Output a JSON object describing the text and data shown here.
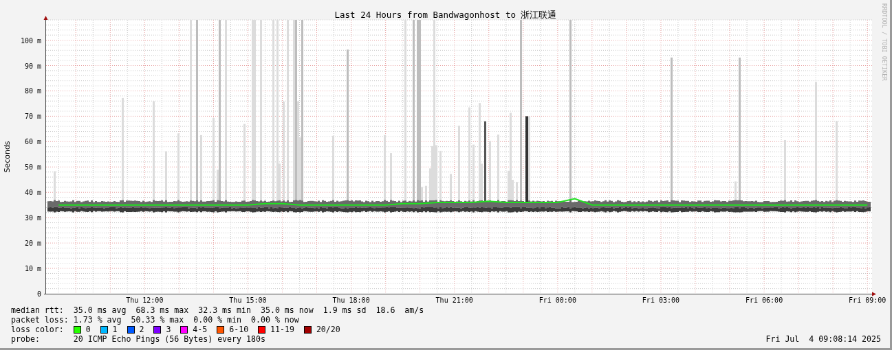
{
  "chart_data": {
    "type": "line",
    "title": "Last 24 Hours from Bandwagonhost to 浙江联通",
    "ylabel": "Seconds",
    "categories": [
      null,
      null,
      null,
      null,
      null,
      "Thu 12:00",
      null,
      null,
      null,
      null,
      null,
      "Thu 15:00",
      null,
      null,
      null,
      null,
      null,
      "Thu 18:00",
      null,
      null,
      null,
      null,
      null,
      "Thu 21:00",
      null,
      null,
      null,
      null,
      null,
      "Fri 00:00",
      null,
      null,
      null,
      null,
      null,
      "Fri 03:00",
      null,
      null,
      null,
      null,
      null,
      "Fri 06:00",
      null,
      null,
      null,
      null,
      null,
      "Fri 09:00"
    ],
    "series": [
      {
        "name": "median rtt:",
        "color": "#20e020",
        "values": [
          35,
          35,
          35,
          35,
          35,
          35,
          35,
          35,
          35,
          35,
          35,
          35,
          35.5,
          35.5,
          35,
          35,
          35,
          35,
          35,
          35,
          35.5,
          35.5,
          36,
          36,
          36,
          36.5,
          36,
          36,
          36,
          36,
          37.5,
          35,
          35,
          35,
          35,
          35,
          35,
          35,
          35,
          35,
          35,
          35,
          35,
          35,
          35,
          35,
          35,
          35
        ]
      }
    ],
    "ylim": [
      0,
      108
    ],
    "grid": true,
    "yticks": [
      {
        "value": 0,
        "label": "0"
      },
      {
        "value": 10,
        "label": "10 m"
      },
      {
        "value": 20,
        "label": "20 m"
      },
      {
        "value": 30,
        "label": "30 m"
      },
      {
        "value": 40,
        "label": "40 m"
      },
      {
        "value": 50,
        "label": "50 m"
      },
      {
        "value": 60,
        "label": "60 m"
      },
      {
        "value": 70,
        "label": "70 m"
      },
      {
        "value": 80,
        "label": "80 m"
      },
      {
        "value": 90,
        "label": "90 m"
      },
      {
        "value": 100,
        "label": "100 m"
      }
    ]
  },
  "credit": "RRDTOOL / TOBI OETIKER",
  "legend": {
    "median_rtt": {
      "values": [
        "35.0 ms avg",
        "68.3 ms max",
        "32.3 ms min",
        "35.0 ms now",
        "1.9 ms sd",
        "18.6",
        "am/s"
      ]
    },
    "packet_loss": {
      "label": "packet loss:",
      "values": [
        "1.73 % avg",
        "50.33 % max",
        "0.00 % min",
        "0.00 % now"
      ]
    },
    "loss_color": {
      "label": "loss color:",
      "items": [
        {
          "label": "0",
          "color": "#26ff00"
        },
        {
          "label": "1",
          "color": "#00b8ff"
        },
        {
          "label": "2",
          "color": "#0059ff"
        },
        {
          "label": "3",
          "color": "#7e00ff"
        },
        {
          "label": "4-5",
          "color": "#ff00ff"
        },
        {
          "label": "6-10",
          "color": "#ff5500"
        },
        {
          "label": "11-19",
          "color": "#ff0000"
        },
        {
          "label": "20/20",
          "color": "#a10000"
        }
      ]
    },
    "probe": {
      "label": "probe:",
      "value": "20 ICMP Echo Pings (56 Bytes) every 180s"
    },
    "timestamp": "Fri Jul  4 09:08:14 2025"
  }
}
